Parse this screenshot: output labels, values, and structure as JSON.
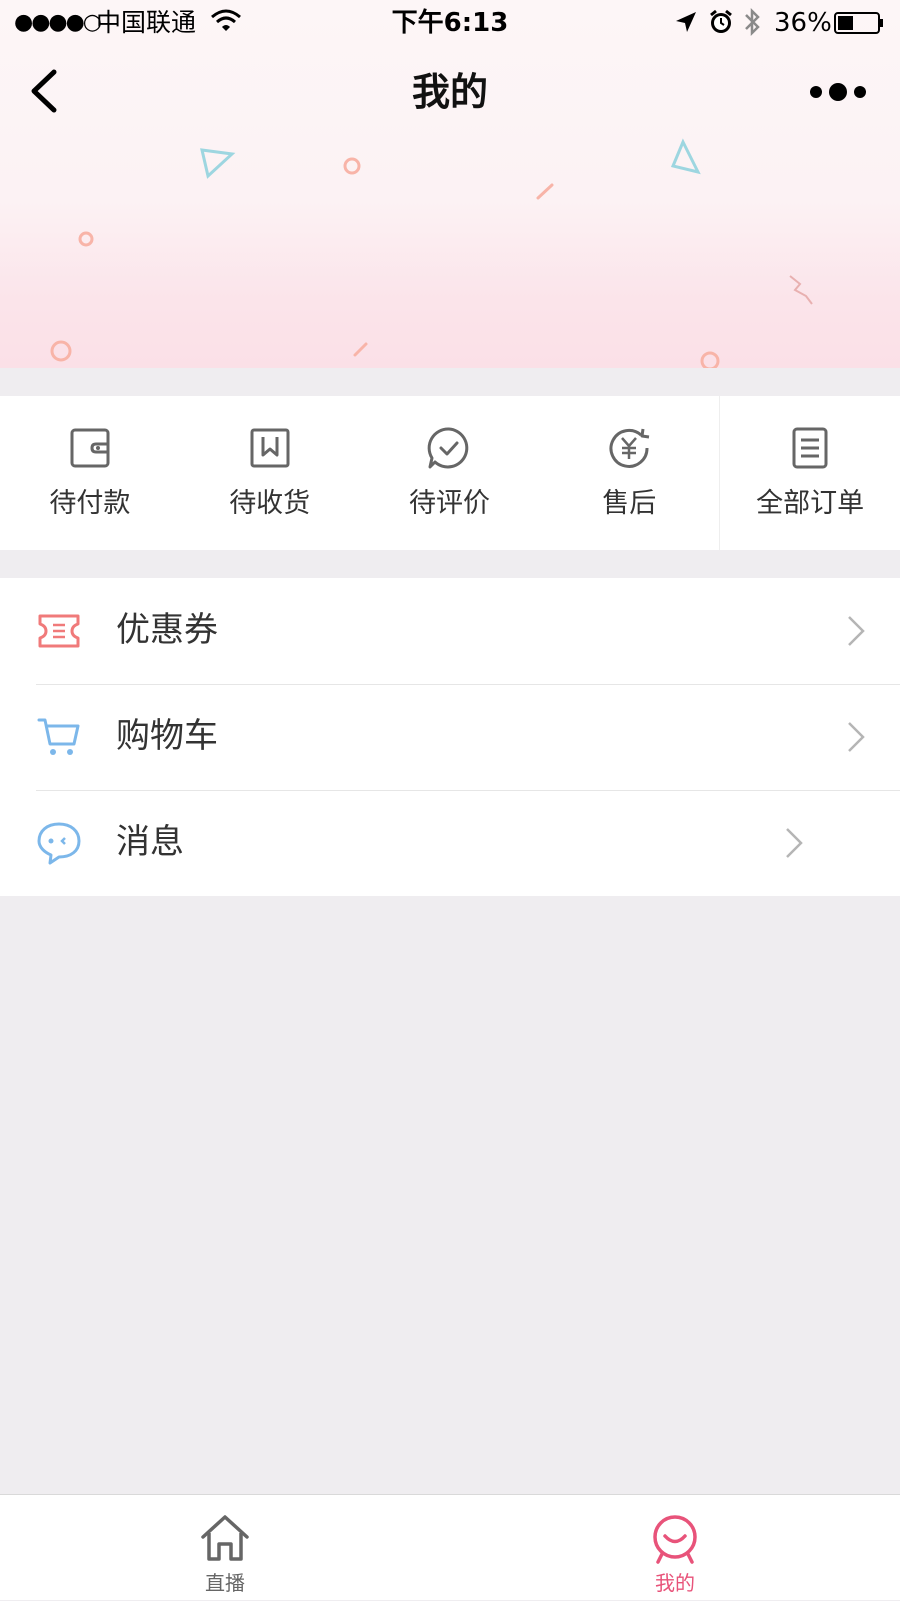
{
  "status_bar": {
    "signal": "●●●●○",
    "carrier": "中国联通",
    "time": "下午6:13",
    "battery": "36%",
    "icons": [
      "wifi-icon",
      "location-arrow-icon",
      "alarm-icon",
      "bluetooth-icon",
      "battery-icon"
    ]
  },
  "nav": {
    "title": "我的",
    "back_icon": "chevron-left-icon",
    "more_icon": "more-dots-icon"
  },
  "orders": [
    {
      "label": "待付款",
      "icon": "wallet-icon"
    },
    {
      "label": "待收货",
      "icon": "package-icon"
    },
    {
      "label": "待评价",
      "icon": "chat-check-icon"
    },
    {
      "label": "售后",
      "icon": "yuan-refund-icon"
    },
    {
      "label": "全部订单",
      "icon": "order-list-icon"
    }
  ],
  "menu": [
    {
      "label": "优惠券",
      "icon": "coupon-icon"
    },
    {
      "label": "购物车",
      "icon": "cart-icon"
    },
    {
      "label": "消息",
      "icon": "message-icon"
    }
  ],
  "tabbar": [
    {
      "label": "直播",
      "icon": "home-icon",
      "active": false
    },
    {
      "label": "我的",
      "icon": "smile-face-icon",
      "active": true
    }
  ],
  "colors": {
    "accent": "#e8537a",
    "coupon": "#f07a7a",
    "cart": "#7cb7ea",
    "message": "#7cb7ea",
    "tab_inactive": "#666666",
    "background": "#efedf0"
  }
}
